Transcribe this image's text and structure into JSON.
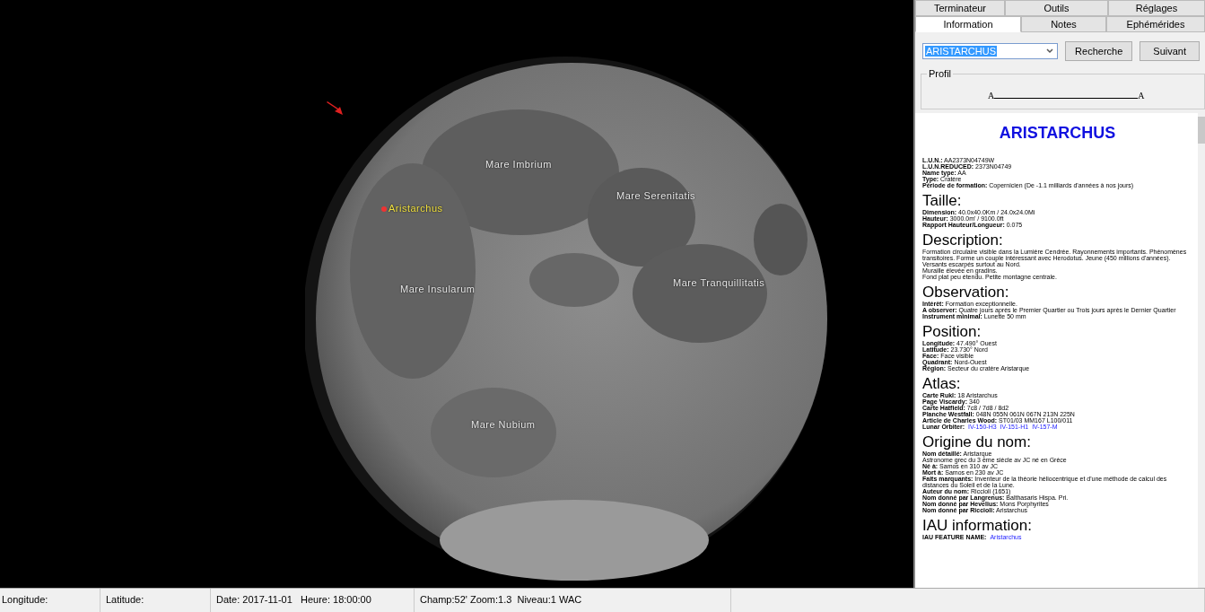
{
  "map": {
    "labels": [
      {
        "text": "Mare Imbrium",
        "kind": "feature"
      },
      {
        "text": "Aristarchus",
        "kind": "selected"
      },
      {
        "text": "Mare Serenitatis",
        "kind": "feature"
      },
      {
        "text": "Mare Insularum",
        "kind": "feature"
      },
      {
        "text": "Mare Tranquillitatis",
        "kind": "feature"
      },
      {
        "text": "Mare Nubium",
        "kind": "feature"
      }
    ]
  },
  "tab_rows": [
    [
      {
        "label": "Terminateur",
        "selected": false
      },
      {
        "label": "Outils",
        "selected": false
      },
      {
        "label": "Réglages",
        "selected": false
      }
    ],
    [
      {
        "label": "Information",
        "selected": true
      },
      {
        "label": "Notes",
        "selected": false
      },
      {
        "label": "Ephémérides",
        "selected": false
      }
    ]
  ],
  "search": {
    "value": "ARISTARCHUS",
    "buttons": [
      "Recherche",
      "Suivant"
    ]
  },
  "profile": {
    "title": "Profil",
    "start": "A",
    "end": "A"
  },
  "info": {
    "title": "ARISTARCHUS",
    "sections": [
      {
        "lines": [
          {
            "text": "**L.U.N.:** AA2373N04749W"
          },
          {
            "text": "**L.U.N.REDUCED:** 2373N04749"
          },
          {
            "text": "**Name type:** AA"
          },
          {
            "text": "**Type:** Cratère"
          },
          {
            "text": "**Période de formation:** Copernicien (De -1.1 milliards d'années à nos jours)"
          }
        ]
      },
      {
        "heading": "Taille:",
        "lines": [
          {
            "text": "**Dimension:** 40.0x40.0Km / 24.0x24.0Mi"
          },
          {
            "text": "**Hauteur:** 3000.0m' / 9100.0ft"
          },
          {
            "text": "**Rapport Hauteur/Longueur:** 0.075"
          }
        ]
      },
      {
        "heading": "Description:",
        "lines": [
          {
            "text": "Formation circulaire visible dans la Lumière Cendrée. Rayonnements importants. Phénomènes transitoires. Forme un couple intéressant avec Herodotus. Jeune (450 millions d'années)."
          },
          {
            "text": "Versants escarpés surtout au Nord."
          },
          {
            "text": "Muraille élevée en gradins."
          },
          {
            "text": "Fond plat peu étendu. Petite montagne centrale."
          }
        ]
      },
      {
        "heading": "Observation:",
        "lines": [
          {
            "text": "**Intérêt:** Formation exceptionnelle."
          },
          {
            "text": "**A observer:** Quatre jours après le Premier Quartier ou Trois jours après le Dernier Quartier"
          },
          {
            "text": "**Instrument minimal:** Lunette 50 mm"
          }
        ]
      },
      {
        "heading": "Position:",
        "lines": [
          {
            "text": "**Longitude:** 47.490° Ouest"
          },
          {
            "text": "**Latitude:** 23.730° Nord"
          },
          {
            "text": "**Face:** Face visible"
          },
          {
            "text": "**Quadrant:** Nord-Ouest"
          },
          {
            "text": "**Région:** Secteur du cratère Aristarque"
          }
        ]
      },
      {
        "heading": "Atlas:",
        "lines": [
          {
            "text": "**Carte Rukl:** 18 Aristarchus"
          },
          {
            "text": "**Page Viscardy:** 340"
          },
          {
            "text": "**Carte Hatfield:** 7c8 / 7d8 / 8d2"
          },
          {
            "text": "**Planche Westfall:** 048N 055N 061N 067N 213N 225N"
          },
          {
            "text": "**Article de Charles Wood:** ST01/03 MM167 L100/011"
          },
          {
            "text": "**Lunar Orbiter:**",
            "links": [
              "IV-150-H3",
              "IV-151-H1",
              "IV-157-M"
            ]
          }
        ]
      },
      {
        "heading": "Origine du nom:",
        "lines": [
          {
            "text": "**Nom détaillé:** Aristarque"
          },
          {
            "text": "Astronome grec du 3 ème siècle av JC né en Grèce"
          },
          {
            "text": "**Né à:** Samos en 310 av JC"
          },
          {
            "text": "**Mort à:** Samos en 230 av JC"
          },
          {
            "text": "**Faits marquants:** Inventeur de la théorie héliocentrique et d'une méthode de calcul des distances du Soleil et de la Lune."
          },
          {
            "text": "**Auteur du nom:** Riccioli (1651)"
          },
          {
            "text": "**Nom donné par Langrenus:** Balthasaris Hispa. Pri."
          },
          {
            "text": "**Nom donné par Hevelius:** Mons Porphyrites"
          },
          {
            "text": "**Nom donné par Riccioli:** Aristarchus"
          }
        ]
      },
      {
        "heading": "IAU information:",
        "lines": [
          {
            "text": "**IAU FEATURE NAME:**",
            "links": [
              "Aristarchus"
            ]
          }
        ]
      }
    ]
  },
  "status_bar": [
    "Longitude:",
    "Latitude:",
    "Date: 2017-11-01   Heure: 18:00:00",
    "Champ:52' Zoom:1.3  Niveau:1 WAC"
  ]
}
